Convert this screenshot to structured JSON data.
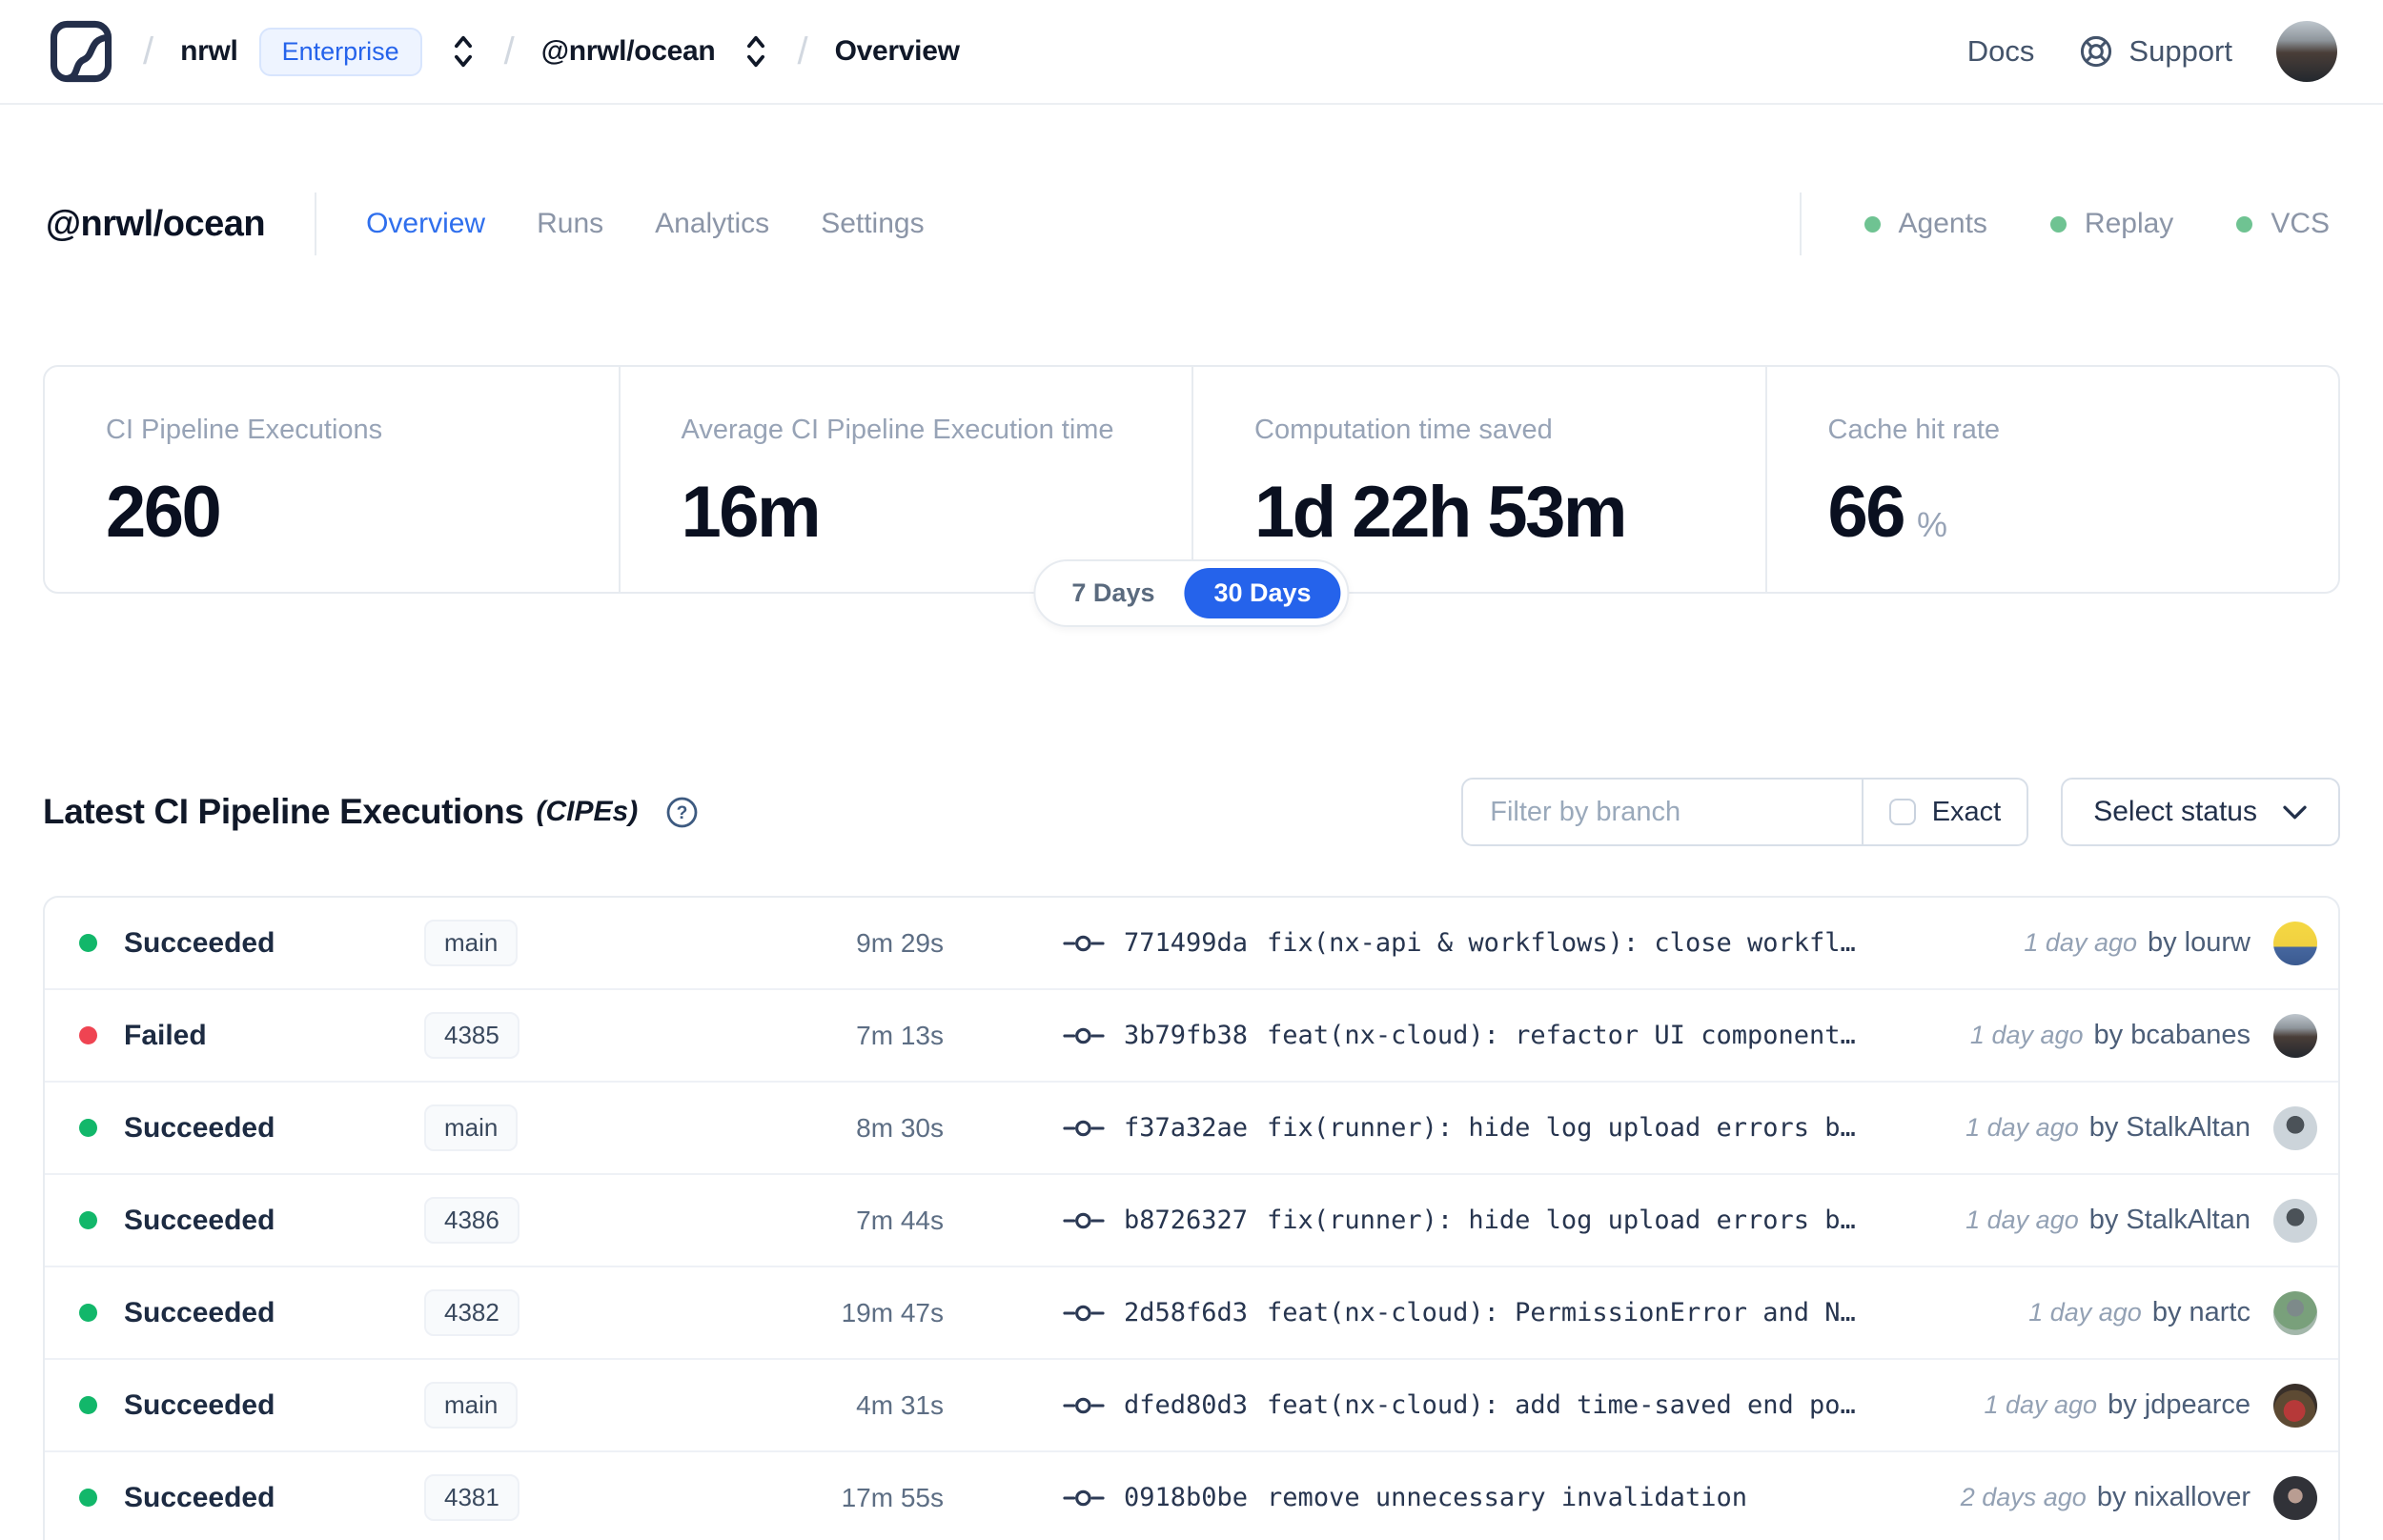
{
  "colors": {
    "accent": "#2563eb",
    "success": "#12b76a",
    "failed": "#ef4452",
    "env-dot": "#6fc392"
  },
  "header": {
    "logo": "nx-cloud-logo",
    "breadcrumb": {
      "org": "nrwl",
      "org_badge": "Enterprise",
      "workspace": "@nrwl/ocean",
      "page": "Overview"
    },
    "docs_label": "Docs",
    "support_label": "Support",
    "avatar_gradient": "linear-gradient(180deg,#bfc7ce 0%,#8e959b 32%,#4a3e38 52%,#23282e 100%)"
  },
  "workspace_bar": {
    "title": "@nrwl/ocean",
    "tabs": [
      {
        "label": "Overview",
        "active": true
      },
      {
        "label": "Runs",
        "active": false
      },
      {
        "label": "Analytics",
        "active": false
      },
      {
        "label": "Settings",
        "active": false
      }
    ],
    "integrations": [
      {
        "label": "Agents"
      },
      {
        "label": "Replay"
      },
      {
        "label": "VCS"
      }
    ]
  },
  "stats": {
    "cards": [
      {
        "label": "CI Pipeline Executions",
        "value": "260",
        "suffix": ""
      },
      {
        "label": "Average CI Pipeline Execution time",
        "value": "16m",
        "suffix": ""
      },
      {
        "label": "Computation time saved",
        "value": "1d 22h 53m",
        "suffix": ""
      },
      {
        "label": "Cache hit rate",
        "value": "66",
        "suffix": "%"
      }
    ],
    "range_toggle": {
      "options": [
        "7 Days",
        "30 Days"
      ],
      "selected": "30 Days"
    }
  },
  "cipes": {
    "title": "Latest CI Pipeline Executions",
    "title_suffix": "(CIPEs)",
    "filter": {
      "branch_placeholder": "Filter by branch",
      "exact_label": "Exact",
      "status_button_label": "Select status"
    },
    "rows": [
      {
        "status": "Succeeded",
        "status_color": "#12b76a",
        "branch": "main",
        "duration": "9m 29s",
        "commit_hash": "771499da",
        "commit_message": "fix(nx-api & workflows): close workfl…",
        "time": "1 day ago",
        "author": "by lourw",
        "avatar_name": "lourw",
        "avatar_gradient": "linear-gradient(180deg,#f5d843 0%,#f0d040 58%,#46679f 58%,#3b5a90 100%)"
      },
      {
        "status": "Failed",
        "status_color": "#ef4452",
        "branch": "4385",
        "duration": "7m 13s",
        "commit_hash": "3b79fb38",
        "commit_message": "feat(nx-cloud): refactor UI component…",
        "time": "1 day ago",
        "author": "by bcabanes",
        "avatar_name": "bcabanes",
        "avatar_gradient": "linear-gradient(180deg,#bfc7ce 0%,#8e959b 32%,#4a3e38 52%,#23282e 100%)"
      },
      {
        "status": "Succeeded",
        "status_color": "#12b76a",
        "branch": "main",
        "duration": "8m 30s",
        "commit_hash": "f37a32ae",
        "commit_message": "fix(runner): hide log upload errors b…",
        "time": "1 day ago",
        "author": "by StalkAltan",
        "avatar_name": "StalkAltan",
        "avatar_gradient": "radial-gradient(circle at 50% 42%,#4b5258 0 26%,#ccd4da 27% 100%)"
      },
      {
        "status": "Succeeded",
        "status_color": "#12b76a",
        "branch": "4386",
        "duration": "7m 44s",
        "commit_hash": "b8726327",
        "commit_message": "fix(runner): hide log upload errors b…",
        "time": "1 day ago",
        "author": "by StalkAltan",
        "avatar_name": "StalkAltan",
        "avatar_gradient": "radial-gradient(circle at 50% 42%,#4b5258 0 26%,#ccd4da 27% 100%)"
      },
      {
        "status": "Succeeded",
        "status_color": "#12b76a",
        "branch": "4382",
        "duration": "19m 47s",
        "commit_hash": "2d58f6d3",
        "commit_message": "feat(nx-cloud): PermissionError and N…",
        "time": "1 day ago",
        "author": "by nartc",
        "avatar_name": "nartc",
        "avatar_gradient": "radial-gradient(circle at 50% 38%,#7d8a8a 0 24%,#79a07b 25% 62%,#a3b7aa 63%)"
      },
      {
        "status": "Succeeded",
        "status_color": "#12b76a",
        "branch": "main",
        "duration": "4m 31s",
        "commit_hash": "dfed80d3",
        "commit_message": "feat(nx-cloud): add time-saved end po…",
        "time": "1 day ago",
        "author": "by jdpearce",
        "avatar_name": "jdpearce",
        "avatar_gradient": "radial-gradient(circle at 48% 62%,#b63939 0 30%,#5d4a33 31% 58%,#39302a 59%)"
      },
      {
        "status": "Succeeded",
        "status_color": "#12b76a",
        "branch": "4381",
        "duration": "17m 55s",
        "commit_hash": "0918b0be",
        "commit_message": "remove unnecessary invalidation",
        "time": "2 days ago",
        "author": "by nixallover",
        "avatar_name": "nixallover",
        "avatar_gradient": "radial-gradient(circle at 50% 45%,#b99d92 0 22%,#313238 23%)"
      }
    ]
  }
}
